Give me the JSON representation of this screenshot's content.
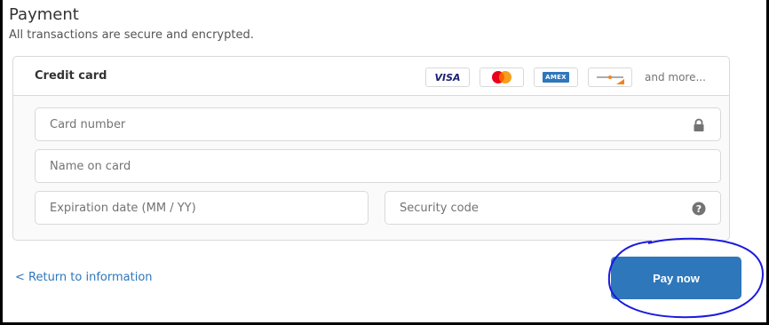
{
  "payment": {
    "title": "Payment",
    "subtitle": "All transactions are secure and encrypted."
  },
  "card": {
    "label": "Credit card",
    "brands": {
      "visa": "VISA",
      "mastercard": "mastercard-logo",
      "amex": "AMEX",
      "generic": "card-logo"
    },
    "more_text": "and more..."
  },
  "fields": {
    "card_number": {
      "placeholder": "Card number",
      "icon": "lock-icon"
    },
    "name_on_card": {
      "placeholder": "Name on card"
    },
    "expiration": {
      "placeholder": "Expiration date (MM / YY)"
    },
    "security_code": {
      "placeholder": "Security code",
      "icon": "help-icon"
    }
  },
  "nav": {
    "return_label": "< Return to information",
    "pay_label": "Pay now"
  },
  "colors": {
    "accent": "#2e77bb",
    "annotation": "#1a1adf",
    "border": "#d9d9d9",
    "text_muted": "#737373"
  }
}
